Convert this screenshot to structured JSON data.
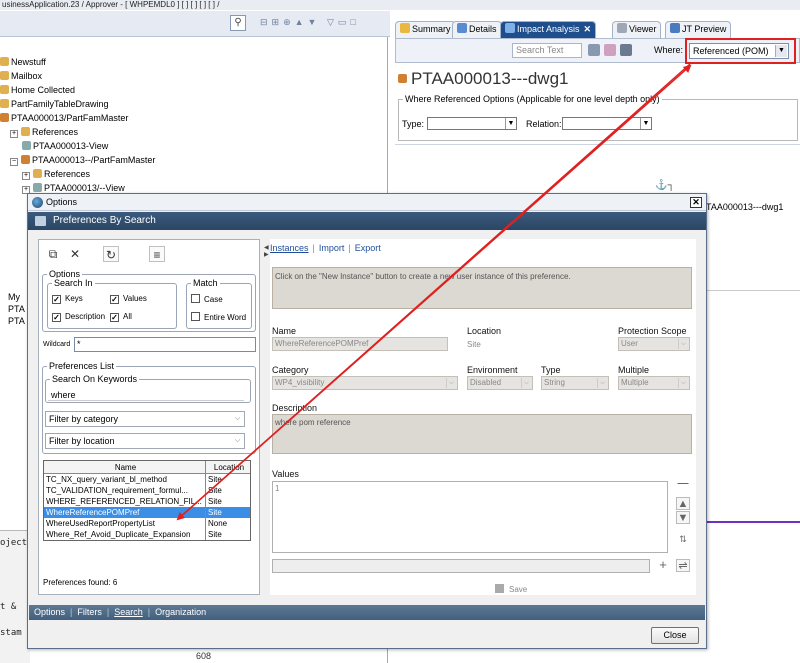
{
  "window_title": "usinessApplication.23 / Approver - [ WHPEMDL0 ] [ ] [ ] [ ] [ ] /",
  "left_panel": {
    "tree": [
      {
        "label": "Newstuff",
        "icon": "folder"
      },
      {
        "label": "Mailbox",
        "icon": "folder"
      },
      {
        "label": "Home Collected",
        "icon": "folder"
      },
      {
        "label": "PartFamilyTableDrawing",
        "icon": "folder"
      },
      {
        "label": "PTAA000013/PartFamMaster",
        "icon": "item"
      },
      {
        "label": "References",
        "icon": "folder"
      },
      {
        "label": "PTAA000013-View",
        "icon": "view"
      },
      {
        "label": "PTAA000013--/PartFamMaster",
        "icon": "item"
      },
      {
        "label": "References",
        "icon": "folder"
      },
      {
        "label": "PTAA000013/--View",
        "icon": "view"
      }
    ],
    "partial_labels": [
      "My",
      "PTA",
      "PTA"
    ],
    "bottom_text": [
      "oject",
      "t &",
      "stam"
    ],
    "bottom_number": "608"
  },
  "right_panel": {
    "tabs": [
      {
        "label": "Summary"
      },
      {
        "label": "Details"
      },
      {
        "label": "Impact Analysis",
        "active": true
      },
      {
        "label": "Viewer"
      },
      {
        "label": "JT Preview"
      }
    ],
    "search_placeholder": "Search Text",
    "where_label": "Where:",
    "where_value": "Referenced (POM)",
    "object_title": "PTAA000013---dwg1",
    "where_ref_options_legend": "Where Referenced Options (Applicable for one level depth only)",
    "type_label": "Type:",
    "relation_label": "Relation:",
    "graph_node": "TAA000013---dwg1"
  },
  "dialog": {
    "title": "Options",
    "header": "Preferences By Search",
    "options": {
      "legend": "Options",
      "search_in_legend": "Search In",
      "keys": "Keys",
      "values": "Values",
      "description": "Description",
      "all": "All",
      "match_legend": "Match",
      "case": "Case",
      "entire_word": "Entire Word",
      "wildcard_label": "Wildcard",
      "wildcard_value": "*"
    },
    "preferences_list": {
      "legend": "Preferences List",
      "search_on_keywords_legend": "Search On Keywords",
      "keyword": "where",
      "filter_category": "Filter by category",
      "filter_location": "Filter by location",
      "columns": [
        "Name",
        "Location"
      ],
      "rows": [
        {
          "name": "TC_NX_query_variant_bl_method",
          "location": "Site"
        },
        {
          "name": "TC_VALIDATION_requirement_formul...",
          "location": "Site"
        },
        {
          "name": "WHERE_REFERENCED_RELATION_FIL...",
          "location": "Site"
        },
        {
          "name": "WhereReferencePOMPref",
          "location": "Site",
          "selected": true
        },
        {
          "name": "WhereUsedReportPropertyList",
          "location": "None"
        },
        {
          "name": "Where_Ref_Avoid_Duplicate_Expansion",
          "location": "Site"
        }
      ],
      "found": "Preferences found: 6"
    },
    "right": {
      "tabs": [
        "Instances",
        "Import",
        "Export"
      ],
      "info": "Click on the \"New Instance\" button to create a new user instance of this preference.",
      "name_label": "Name",
      "name_value": "WhereReferencePOMPref",
      "location_label": "Location",
      "location_value": "Site",
      "protection_label": "Protection Scope",
      "protection_value": "User",
      "category_label": "Category",
      "category_value": "WP4_visibility",
      "environment_label": "Environment",
      "environment_value": "Disabled",
      "type_label": "Type",
      "type_value": "String",
      "multiple_label": "Multiple",
      "multiple_value": "Multiple",
      "description_label": "Description",
      "description_value": "where pom reference",
      "values_label": "Values",
      "values_value": "1",
      "save_label": "Save"
    },
    "bottom_tabs": [
      "Options",
      "Filters",
      "Search",
      "Organization"
    ],
    "close_label": "Close"
  },
  "colors": {
    "highlight": "#e02020",
    "selection": "#3a8ee6",
    "header": "#2b4664"
  }
}
